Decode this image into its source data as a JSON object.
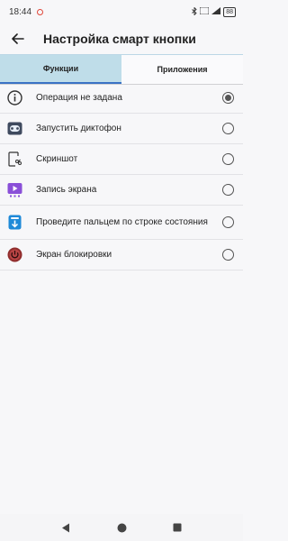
{
  "status_bar": {
    "time": "18:44",
    "battery": "88"
  },
  "app_bar": {
    "title": "Настройка смарт кнопки"
  },
  "tabs": [
    {
      "label": "Функции",
      "active": true
    },
    {
      "label": "Приложения",
      "active": false
    }
  ],
  "options": [
    {
      "label": "Операция не задана",
      "icon": "info-icon",
      "selected": true
    },
    {
      "label": "Запустить диктофон",
      "icon": "recorder-icon",
      "selected": false
    },
    {
      "label": "Скриншот",
      "icon": "screenshot-icon",
      "selected": false
    },
    {
      "label": "Запись экрана",
      "icon": "screen-record-icon",
      "selected": false
    },
    {
      "label": "Проведите пальцем по строке состояния",
      "icon": "swipe-statusbar-icon",
      "selected": false
    },
    {
      "label": "Экран блокировки",
      "icon": "lock-screen-icon",
      "selected": false
    }
  ],
  "colors": {
    "tab_active_bg": "#bfdde9",
    "tab_indicator": "#3a72c4"
  }
}
